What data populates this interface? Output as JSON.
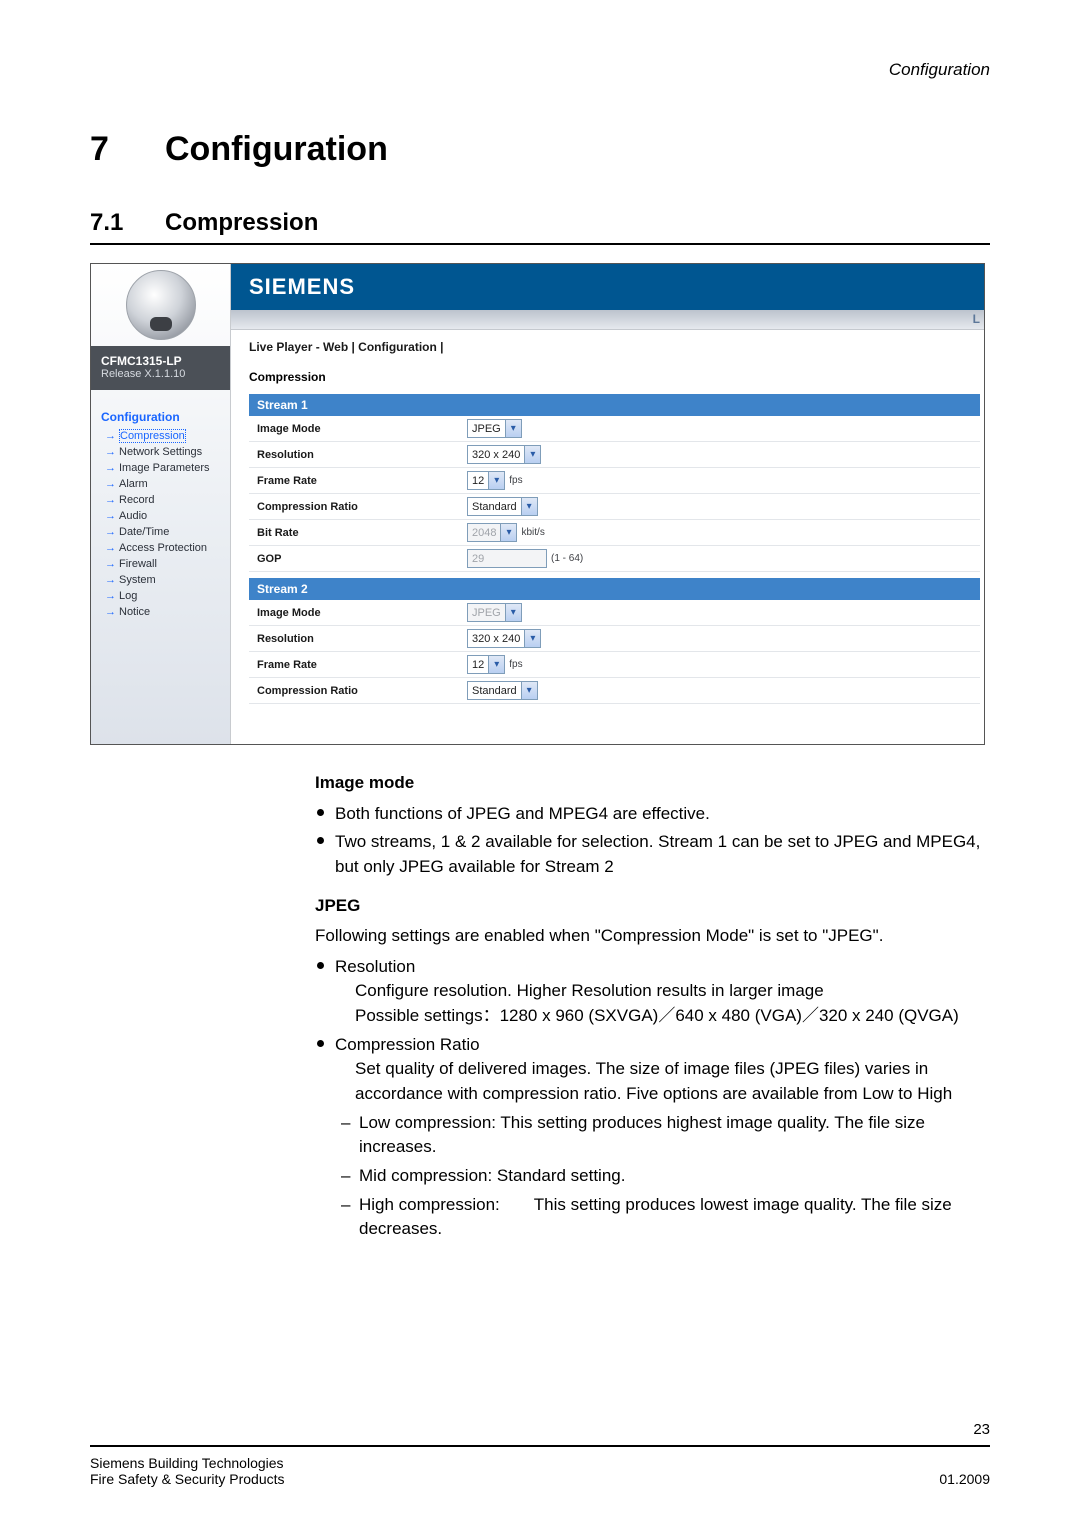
{
  "page": {
    "running_header": "Configuration",
    "chapter_number": "7",
    "chapter_title": "Configuration",
    "section_number": "7.1",
    "section_title": "Compression",
    "page_number": "23"
  },
  "footer": {
    "line1": "Siemens Building Technologies",
    "line2_left": "Fire Safety & Security Products",
    "line2_right": "01.2009"
  },
  "screenshot": {
    "brand": "SIEMENS",
    "brand_bar_letter": "L",
    "sidebar": {
      "model": "CFMC1315-LP",
      "release": "Release X.1.1.10",
      "nav_header": "Configuration",
      "items": [
        {
          "label": "Compression",
          "current": true
        },
        {
          "label": "Network Settings"
        },
        {
          "label": "Image Parameters"
        },
        {
          "label": "Alarm"
        },
        {
          "label": "Record"
        },
        {
          "label": "Audio"
        },
        {
          "label": "Date/Time"
        },
        {
          "label": "Access Protection"
        },
        {
          "label": "Firewall"
        },
        {
          "label": "System"
        },
        {
          "label": "Log"
        },
        {
          "label": "Notice"
        }
      ]
    },
    "breadcrumb": "Live Player - Web  |  Configuration  |",
    "page_title": "Compression",
    "stream1": {
      "header": "Stream 1",
      "rows": {
        "image_mode": {
          "label": "Image Mode",
          "value": "JPEG"
        },
        "resolution": {
          "label": "Resolution",
          "value": "320 x 240"
        },
        "frame_rate": {
          "label": "Frame Rate",
          "value": "12",
          "unit": "fps"
        },
        "compression_ratio": {
          "label": "Compression Ratio",
          "value": "Standard"
        },
        "bit_rate": {
          "label": "Bit Rate",
          "value": "2048",
          "unit": "kbit/s",
          "disabled": true
        },
        "gop": {
          "label": "GOP",
          "value": "29",
          "suffix": "(1 - 64)",
          "disabled": true
        }
      }
    },
    "stream2": {
      "header": "Stream 2",
      "rows": {
        "image_mode": {
          "label": "Image Mode",
          "value": "JPEG",
          "disabled": true
        },
        "resolution": {
          "label": "Resolution",
          "value": "320 x 240"
        },
        "frame_rate": {
          "label": "Frame Rate",
          "value": "12",
          "unit": "fps"
        },
        "compression_ratio": {
          "label": "Compression Ratio",
          "value": "Standard"
        }
      }
    }
  },
  "body": {
    "image_mode_heading": "Image mode",
    "image_mode_b1": "Both functions of JPEG and MPEG4 are effective.",
    "image_mode_b2": "Two streams, 1 & 2 available for selection. Stream 1 can be set to JPEG and MPEG4, but only JPEG available for Stream 2",
    "jpeg_heading": "JPEG",
    "jpeg_intro": "Following settings are enabled when \"Compression Mode\" is set to \"JPEG\".",
    "jpeg_res_title": "Resolution",
    "jpeg_res_l1": "Configure resolution. Higher Resolution results in larger image",
    "jpeg_res_l2": "Possible settings：1280 x 960 (SXVGA)／640 x 480 (VGA)／320 x 240 (QVGA)",
    "jpeg_cr_title": "Compression Ratio",
    "jpeg_cr_l1": "Set quality of delivered images. The size of image files (JPEG files) varies in accordance with compression ratio. Five options are available from Low to High",
    "jpeg_cr_sub1": "Low compression: This setting produces highest image quality. The file size increases.",
    "jpeg_cr_sub2": "Mid compression: Standard setting.",
    "jpeg_cr_sub3": "High compression:  This setting produces lowest image quality. The file size decreases."
  }
}
